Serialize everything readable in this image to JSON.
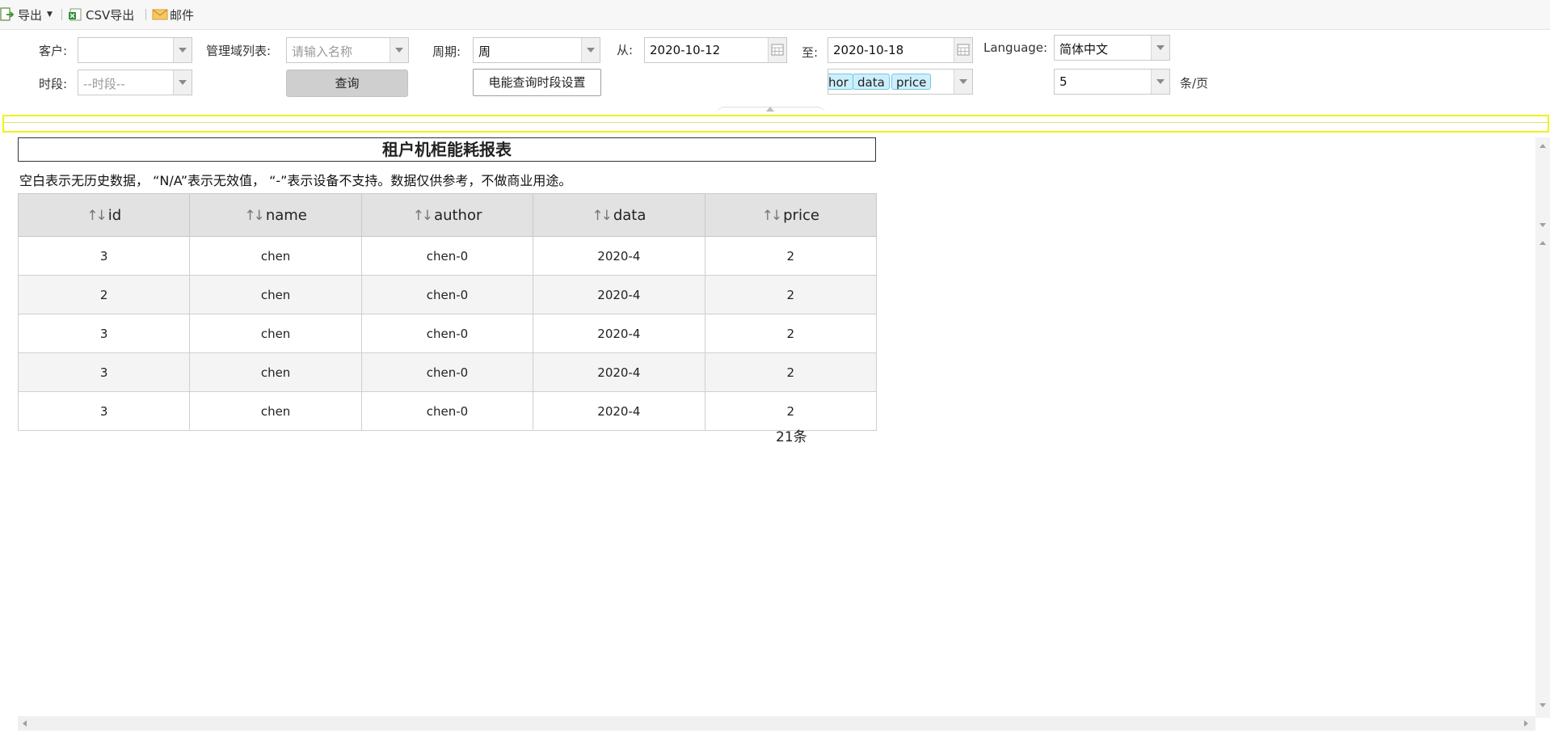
{
  "toolbar": {
    "export_label": "导出",
    "csv_label": "CSV导出",
    "mail_label": "邮件"
  },
  "form": {
    "customer_label": "客户:",
    "customer_value": "",
    "domain_label": "管理域列表:",
    "domain_placeholder": "请输入名称",
    "period_label": "周期:",
    "period_value": "周",
    "from_label": "从:",
    "from_value": "2020-10-12",
    "to_label": "至:",
    "to_value": "2020-10-18",
    "language_label": "Language:",
    "language_value": "简体中文",
    "timeslot_label": "时段:",
    "timeslot_value": "--时段--",
    "query_button": "查询",
    "slot_setting_button": "电能查询时段设置",
    "column_tags": [
      "hor",
      "data",
      "price"
    ],
    "page_size_value": "5",
    "page_size_unit": "条/页"
  },
  "report": {
    "title": "租户机柜能耗报表",
    "note": "空白表示无历史数据， “N/A”表示无效值， “-”表示设备不支持。数据仅供参考，不做商业用途。",
    "columns": [
      "id",
      "name",
      "author",
      "data",
      "price"
    ],
    "rows": [
      [
        "3",
        "chen",
        "chen-0",
        "2020-4",
        "2"
      ],
      [
        "2",
        "chen",
        "chen-0",
        "2020-4",
        "2"
      ],
      [
        "3",
        "chen",
        "chen-0",
        "2020-4",
        "2"
      ],
      [
        "3",
        "chen",
        "chen-0",
        "2020-4",
        "2"
      ],
      [
        "3",
        "chen",
        "chen-0",
        "2020-4",
        "2"
      ]
    ],
    "total_label": "21条"
  },
  "colors": {
    "highlight": "#f1f21a",
    "tag_bg": "#cdeffb",
    "tag_border": "#72c7e4",
    "header_bg": "#e2e2e2"
  }
}
